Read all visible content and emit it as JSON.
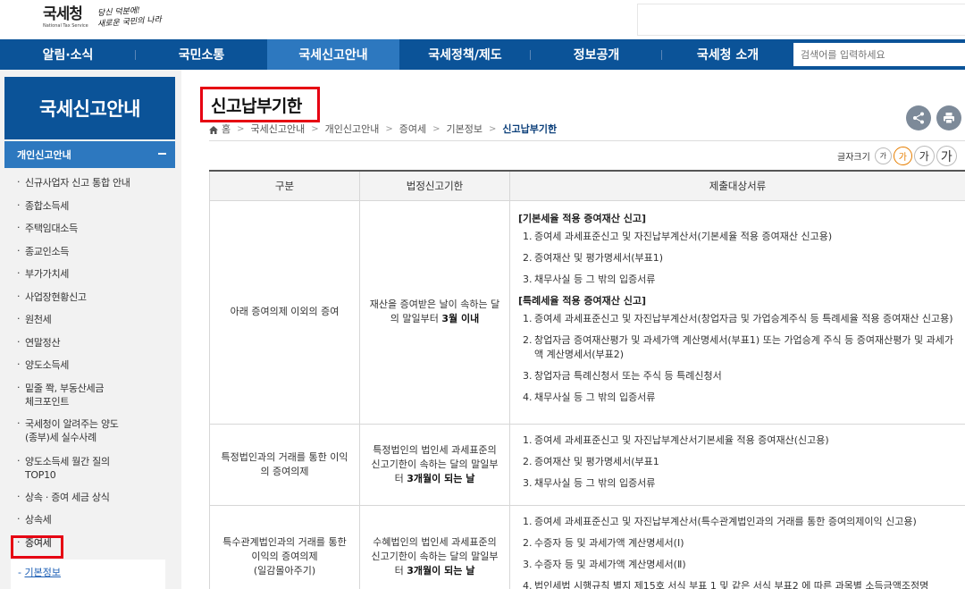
{
  "header": {
    "logo_kr": "국세청",
    "logo_en": "National Tax Service",
    "slogan_line1": "당신 덕분에!",
    "slogan_line2": "새로운 국민의 나라"
  },
  "gnb": {
    "items": [
      {
        "label": "알림·소식"
      },
      {
        "label": "국민소통"
      },
      {
        "label": "국세신고안내"
      },
      {
        "label": "국세정책/제도"
      },
      {
        "label": "정보공개"
      },
      {
        "label": "국세청 소개"
      }
    ],
    "search_placeholder": "검색어를 입력하세요"
  },
  "lnb": {
    "title": "국세신고안내",
    "sub_title": "개인신고안내",
    "items": [
      {
        "label": "신규사업자 신고 통합 안내"
      },
      {
        "label": "종합소득세"
      },
      {
        "label": "주택임대소득"
      },
      {
        "label": "종교인소득"
      },
      {
        "label": "부가가치세"
      },
      {
        "label": "사업장현황신고"
      },
      {
        "label": "원천세"
      },
      {
        "label": "연말정산"
      },
      {
        "label": "양도소득세"
      },
      {
        "label": "밑줄 쫙, 부동산세금\n체크포인트"
      },
      {
        "label": "국세청이 알려주는 양도\n(종부)세 실수사례"
      },
      {
        "label": "양도소득세 월간 질의\nTOP10"
      },
      {
        "label": "상속 · 증여 세금 상식"
      },
      {
        "label": "상속세"
      },
      {
        "label": "증여세"
      }
    ],
    "third": "기본정보"
  },
  "content": {
    "title": "신고납부기한",
    "breadcrumb": [
      "홈",
      "국세신고안내",
      "개인신고안내",
      "증여세",
      "기본정보",
      "신고납부기한"
    ],
    "fontsize_label": "글자크기",
    "fontsize_buttons": [
      "가",
      "가",
      "가",
      "가"
    ],
    "table": {
      "headers": [
        "구분",
        "법정신고기한",
        "제출대상서류"
      ],
      "row1": {
        "category": "아래 증여의제 이외의 증여",
        "deadline_pre": "재산을 증여받은 날이 속하는 달의 말일부터 ",
        "deadline_em": "3월 이내",
        "sec1_title": "[기본세율 적용 증여재산 신고]",
        "sec1_items": [
          "증여세 과세표준신고 및 자진납부계산서(기본세율 적용 증여재산 신고용)",
          "증여재산 및 평가명세서(부표1)",
          "채무사실 등 그 밖의 입증서류"
        ],
        "sec2_title": "[특례세율 적용 증여재산 신고]",
        "sec2_items": [
          "증여세 과세표준신고 및 자진납부계산서(창업자금 및 가업승계주식 등 특례세율 적용 증여재산 신고용)",
          "창업자금 증여재산평가 및 과세가액 계산명세서(부표1) 또는 가업승계 주식 등 증여재산평가 및 과세가액 계산명세서(부표2)",
          "창업자금 특례신청서 또는 주식 등 특례신청서",
          "채무사실 등 그 밖의 입증서류"
        ]
      },
      "row2": {
        "category": "특정법인과의 거래를 통한 이익의 증여의제",
        "deadline_pre": "특정법인의 법인세 과세표준의 신고기한이 속하는 달의 말일부터 ",
        "deadline_em": "3개월이 되는 날",
        "items": [
          "증여세 과세표준신고 및 자진납부계산서기본세율 적용 증여재산(신고용)",
          "증여재산 및 평가명세서(부표1",
          "채무사실 등 그 밖의 입증서류"
        ]
      },
      "row3": {
        "category": "특수관계법인과의 거래를 통한 이익의 증여의제\n(일감몰아주기)",
        "deadline_pre": "수혜법인의 법인세 과세표준의 신고기한이 속하는 달의 말일부터 ",
        "deadline_em": "3개월이 되는 날",
        "items": [
          "증여세 과세표준신고 및 자진납부계산서(특수관계법인과의 거래를 통한 증여의제이익 신고용)",
          "수증자 등 및 과세가액 계산명세서(Ⅰ)",
          "수증자 등 및 과세가액 계산명세서(Ⅱ)",
          "법인세법 시행규칙 별지 제15호 서식 부표 1 및 같은 서식 부표2 에 따른 과목별 소득금액조정명"
        ]
      }
    }
  }
}
